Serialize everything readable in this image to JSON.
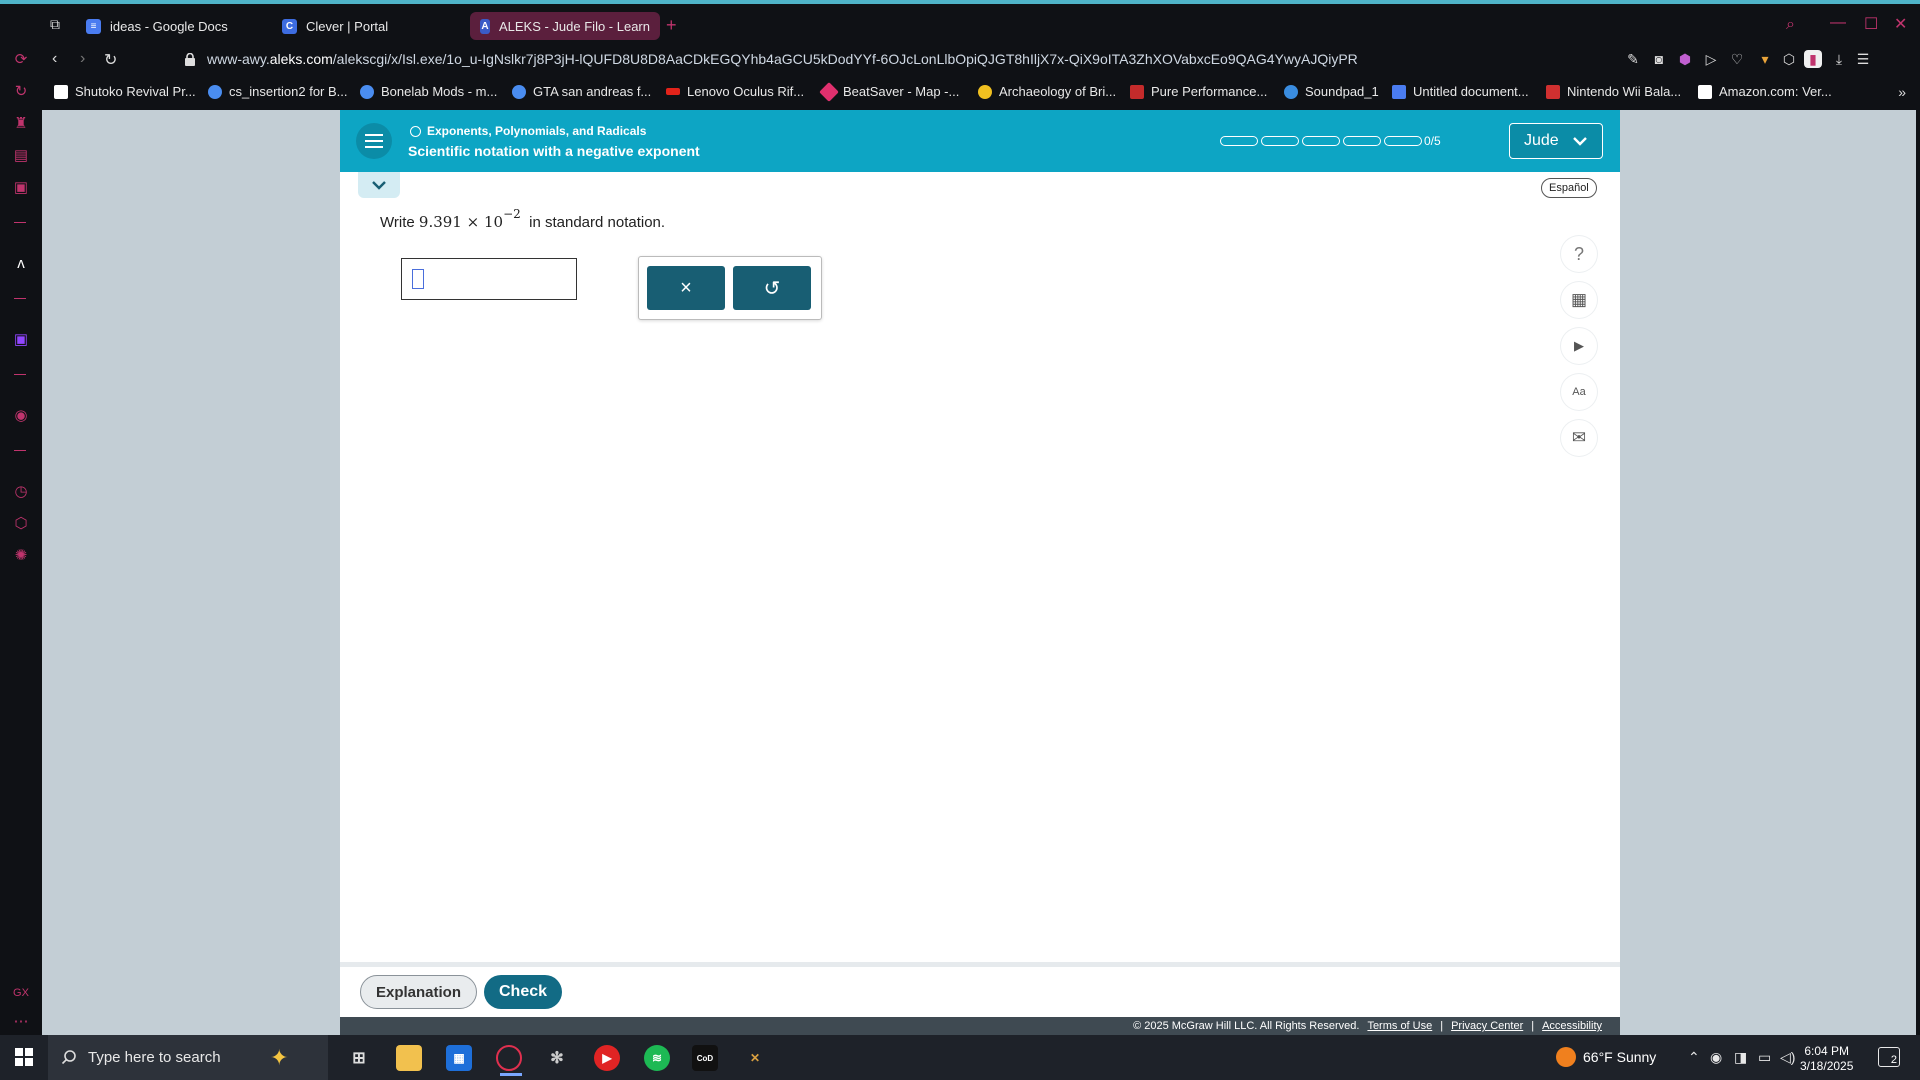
{
  "browser": {
    "tabs": [
      {
        "label": "ideas - Google Docs",
        "icon": "docs-icon",
        "color": "#4a7cf0",
        "glyph": "≡"
      },
      {
        "label": "Clever | Portal",
        "icon": "clever-icon",
        "color": "#3d6ce0",
        "glyph": "C"
      },
      {
        "label": "ALEKS - Jude Filo - Learn",
        "icon": "aleks-icon",
        "color": "#3a5bc7",
        "glyph": "A"
      }
    ],
    "new_tab": "+",
    "url_host": "www-awy.",
    "url_domain": "aleks.com",
    "url_path": "/alekscgi/x/Isl.exe/1o_u-IgNslkr7j8P3jH-lQUFD8U8D8AaCDkEGQYhb4aGCU5kDodYYf-6OJcLonLlbOpiQJGT8hIljX7x-QiX9oITA3ZhXOVabxcEo9QAG4YwyAJQiyPR",
    "bookmarks": [
      {
        "label": "Shutoko Revival Pr...",
        "color": "#ffffff"
      },
      {
        "label": "cs_insertion2 for B...",
        "color": "#4a8df0"
      },
      {
        "label": "Bonelab Mods - m...",
        "color": "#4a8df0"
      },
      {
        "label": "GTA san andreas f...",
        "color": "#4a8df0"
      },
      {
        "label": "Lenovo Oculus Rif...",
        "color": "#e2231a"
      },
      {
        "label": "BeatSaver - Map -...",
        "color": "#e0306e"
      },
      {
        "label": "Archaeology of Bri...",
        "color": "#f0c020"
      },
      {
        "label": "Pure Performance...",
        "color": "#c42b2b"
      },
      {
        "label": "Soundpad_1",
        "color": "#3a8de0"
      },
      {
        "label": "Untitled document...",
        "color": "#4a7cf0"
      },
      {
        "label": "Nintendo Wii Bala...",
        "color": "#d03030"
      },
      {
        "label": "Amazon.com: Ver...",
        "color": "#ffffff"
      }
    ],
    "bookmarks_more": "»"
  },
  "header": {
    "topic": "Exponents, Polynomials, and Radicals",
    "subtopic": "Scientific notation with a negative exponent",
    "progress_done": 0,
    "progress_total": 5,
    "progress_text": "0/5",
    "user_name": "Jude"
  },
  "language_button": "Español",
  "question": {
    "prefix": "Write",
    "coefficient": "9.391",
    "times": "×",
    "base": "10",
    "exponent": "−2",
    "suffix": "in standard notation."
  },
  "answer": {
    "value": ""
  },
  "keypad": {
    "clear": "×",
    "undo": "↺"
  },
  "tools": [
    {
      "name": "help-icon",
      "glyph": "?"
    },
    {
      "name": "calculator-icon",
      "glyph": "▦"
    },
    {
      "name": "video-icon",
      "glyph": "▶"
    },
    {
      "name": "textbook-icon",
      "glyph": "Aa"
    },
    {
      "name": "message-icon",
      "glyph": "✉"
    }
  ],
  "footer": {
    "explanation_label": "Explanation",
    "check_label": "Check",
    "copyright": "© 2025 McGraw Hill LLC. All Rights Reserved.",
    "terms": "Terms of Use",
    "privacy": "Privacy Center",
    "accessibility": "Accessibility",
    "sep": "|"
  },
  "taskbar": {
    "search_placeholder": "Type here to search",
    "weather": "66°F  Sunny",
    "time": "6:04 PM",
    "date": "3/18/2025",
    "notifications": "2"
  },
  "colors": {
    "aleks_teal": "#0da5c4",
    "check_button": "#126b85",
    "keypad_button": "#185e73",
    "browser_accent": "#c0346d"
  }
}
